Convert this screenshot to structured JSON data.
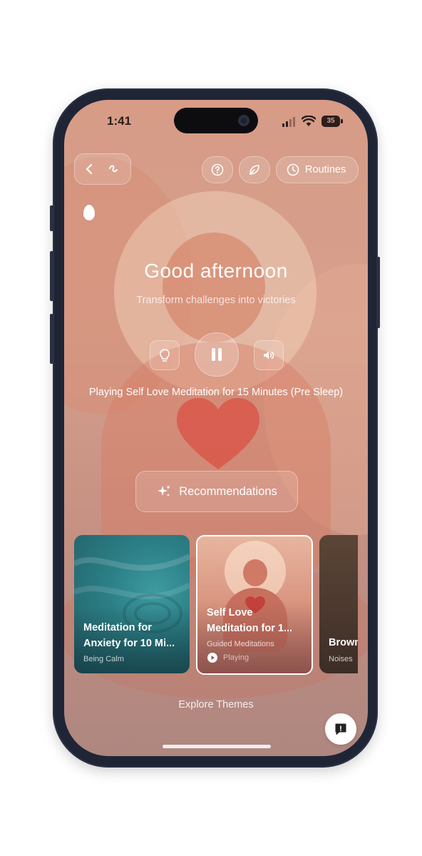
{
  "status_bar": {
    "time": "1:41",
    "battery": "35"
  },
  "top_bar": {
    "routines_label": "Routines"
  },
  "hero": {
    "greeting": "Good afternoon",
    "subtitle": "Transform challenges into victories",
    "now_playing": "Playing Self Love Meditation for 15 Minutes (Pre Sleep)"
  },
  "recommendations_label": "Recommendations",
  "cards": [
    {
      "title_line1": "Meditation for",
      "title_line2": "Anxiety for 10 Mi...",
      "category": "Being Calm"
    },
    {
      "title_line1": "Self Love",
      "title_line2": "Meditation for 1...",
      "category": "Guided Meditations",
      "status": "Playing"
    },
    {
      "title_line1": "Brown",
      "category": "Noises"
    }
  ],
  "explore_label": "Explore Themes",
  "colors": {
    "accent_heart": "#d9574a",
    "background": "#d49a86"
  }
}
